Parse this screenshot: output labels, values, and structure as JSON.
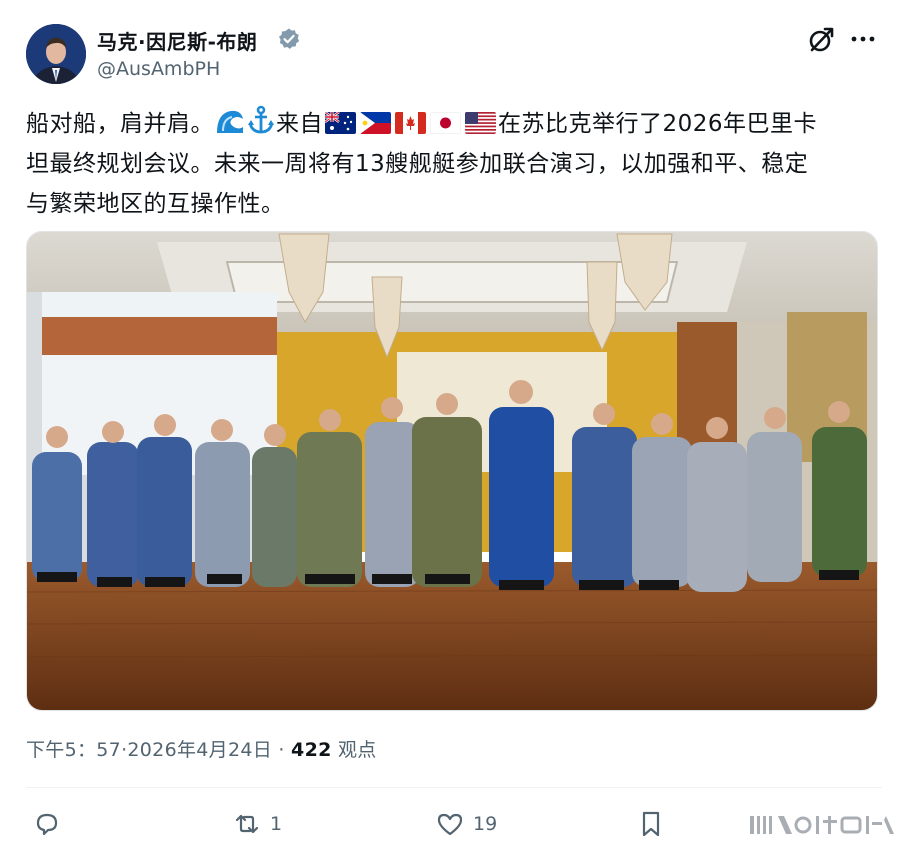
{
  "author": {
    "name": "马克·因尼斯-布朗",
    "handle": "@AusAmbPH",
    "verified": true
  },
  "tweet": {
    "line1_prefix": "船对船，肩并肩。",
    "line1_from": "来自",
    "line1_suffix": "在苏比克举行了2026年巴里卡",
    "line2": "坦最终规划会议。未来一周将有13艘舰艇参加联合演习，以加强和平、稳定",
    "line3": "与繁荣地区的互操作性。",
    "emoji": [
      "wave-emoji",
      "anchor-emoji"
    ],
    "flags": [
      "australia-flag",
      "philippines-flag",
      "canada-flag",
      "japan-flag",
      "usa-flag"
    ]
  },
  "meta": {
    "time_date": "下午5：57·2026年4月24日 · ",
    "views_count": "422",
    "views_label": " 观点"
  },
  "actions": {
    "reply_count": "",
    "repost_count": "1",
    "like_count": "19"
  },
  "colors": {
    "text": "#0f1419",
    "secondary": "#536471",
    "verified_badge": "#829aab",
    "divider": "#eff3f4"
  }
}
